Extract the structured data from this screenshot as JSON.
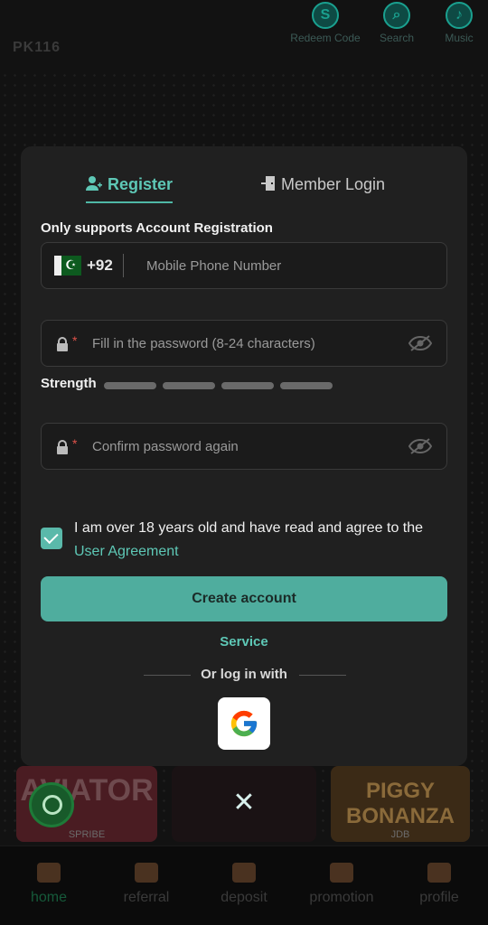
{
  "topbar": {
    "logo": "PK116",
    "items": [
      {
        "label": "Redeem Code",
        "icon": "redeem-code-icon",
        "glyph": "S"
      },
      {
        "label": "Search",
        "icon": "search-icon",
        "glyph": "⌕"
      },
      {
        "label": "Music",
        "icon": "music-icon",
        "glyph": "♪"
      }
    ]
  },
  "modal": {
    "tabs": [
      {
        "label": "Register",
        "icon": "user-add-icon",
        "active": true
      },
      {
        "label": "Member Login",
        "icon": "door-login-icon",
        "active": false
      }
    ],
    "subtitle": "Only supports Account Registration",
    "phone": {
      "country_code": "+92",
      "placeholder": "Mobile Phone Number",
      "flag": "pakistan-flag-icon"
    },
    "password": {
      "placeholder": "Fill in the password (8-24 characters)"
    },
    "strength": {
      "label": "Strength",
      "level": 0,
      "segments": 4
    },
    "confirm_password": {
      "placeholder": "Confirm password again"
    },
    "agreement": {
      "checked": true,
      "text": "I am over 18 years old and have read and agree to the",
      "link": "User Agreement"
    },
    "create_button": "Create account",
    "service_link": "Service",
    "or_login_with": "Or log in with",
    "social": [
      "google"
    ]
  },
  "games": [
    {
      "title": "AVIATOR",
      "sub": "SPRIBE"
    },
    {
      "title": "",
      "sub": ""
    },
    {
      "title": "PIGGY BONANZA",
      "sub": "JDB"
    }
  ],
  "bottom_nav": [
    {
      "label": "home",
      "active": true
    },
    {
      "label": "referral",
      "active": false
    },
    {
      "label": "deposit",
      "active": false
    },
    {
      "label": "promotion",
      "active": false
    },
    {
      "label": "profile",
      "active": false
    }
  ],
  "colors": {
    "accent": "#4fad9e",
    "accent_text": "#5ec8b6",
    "modal_bg": "#202020",
    "page_bg": "#121212"
  }
}
